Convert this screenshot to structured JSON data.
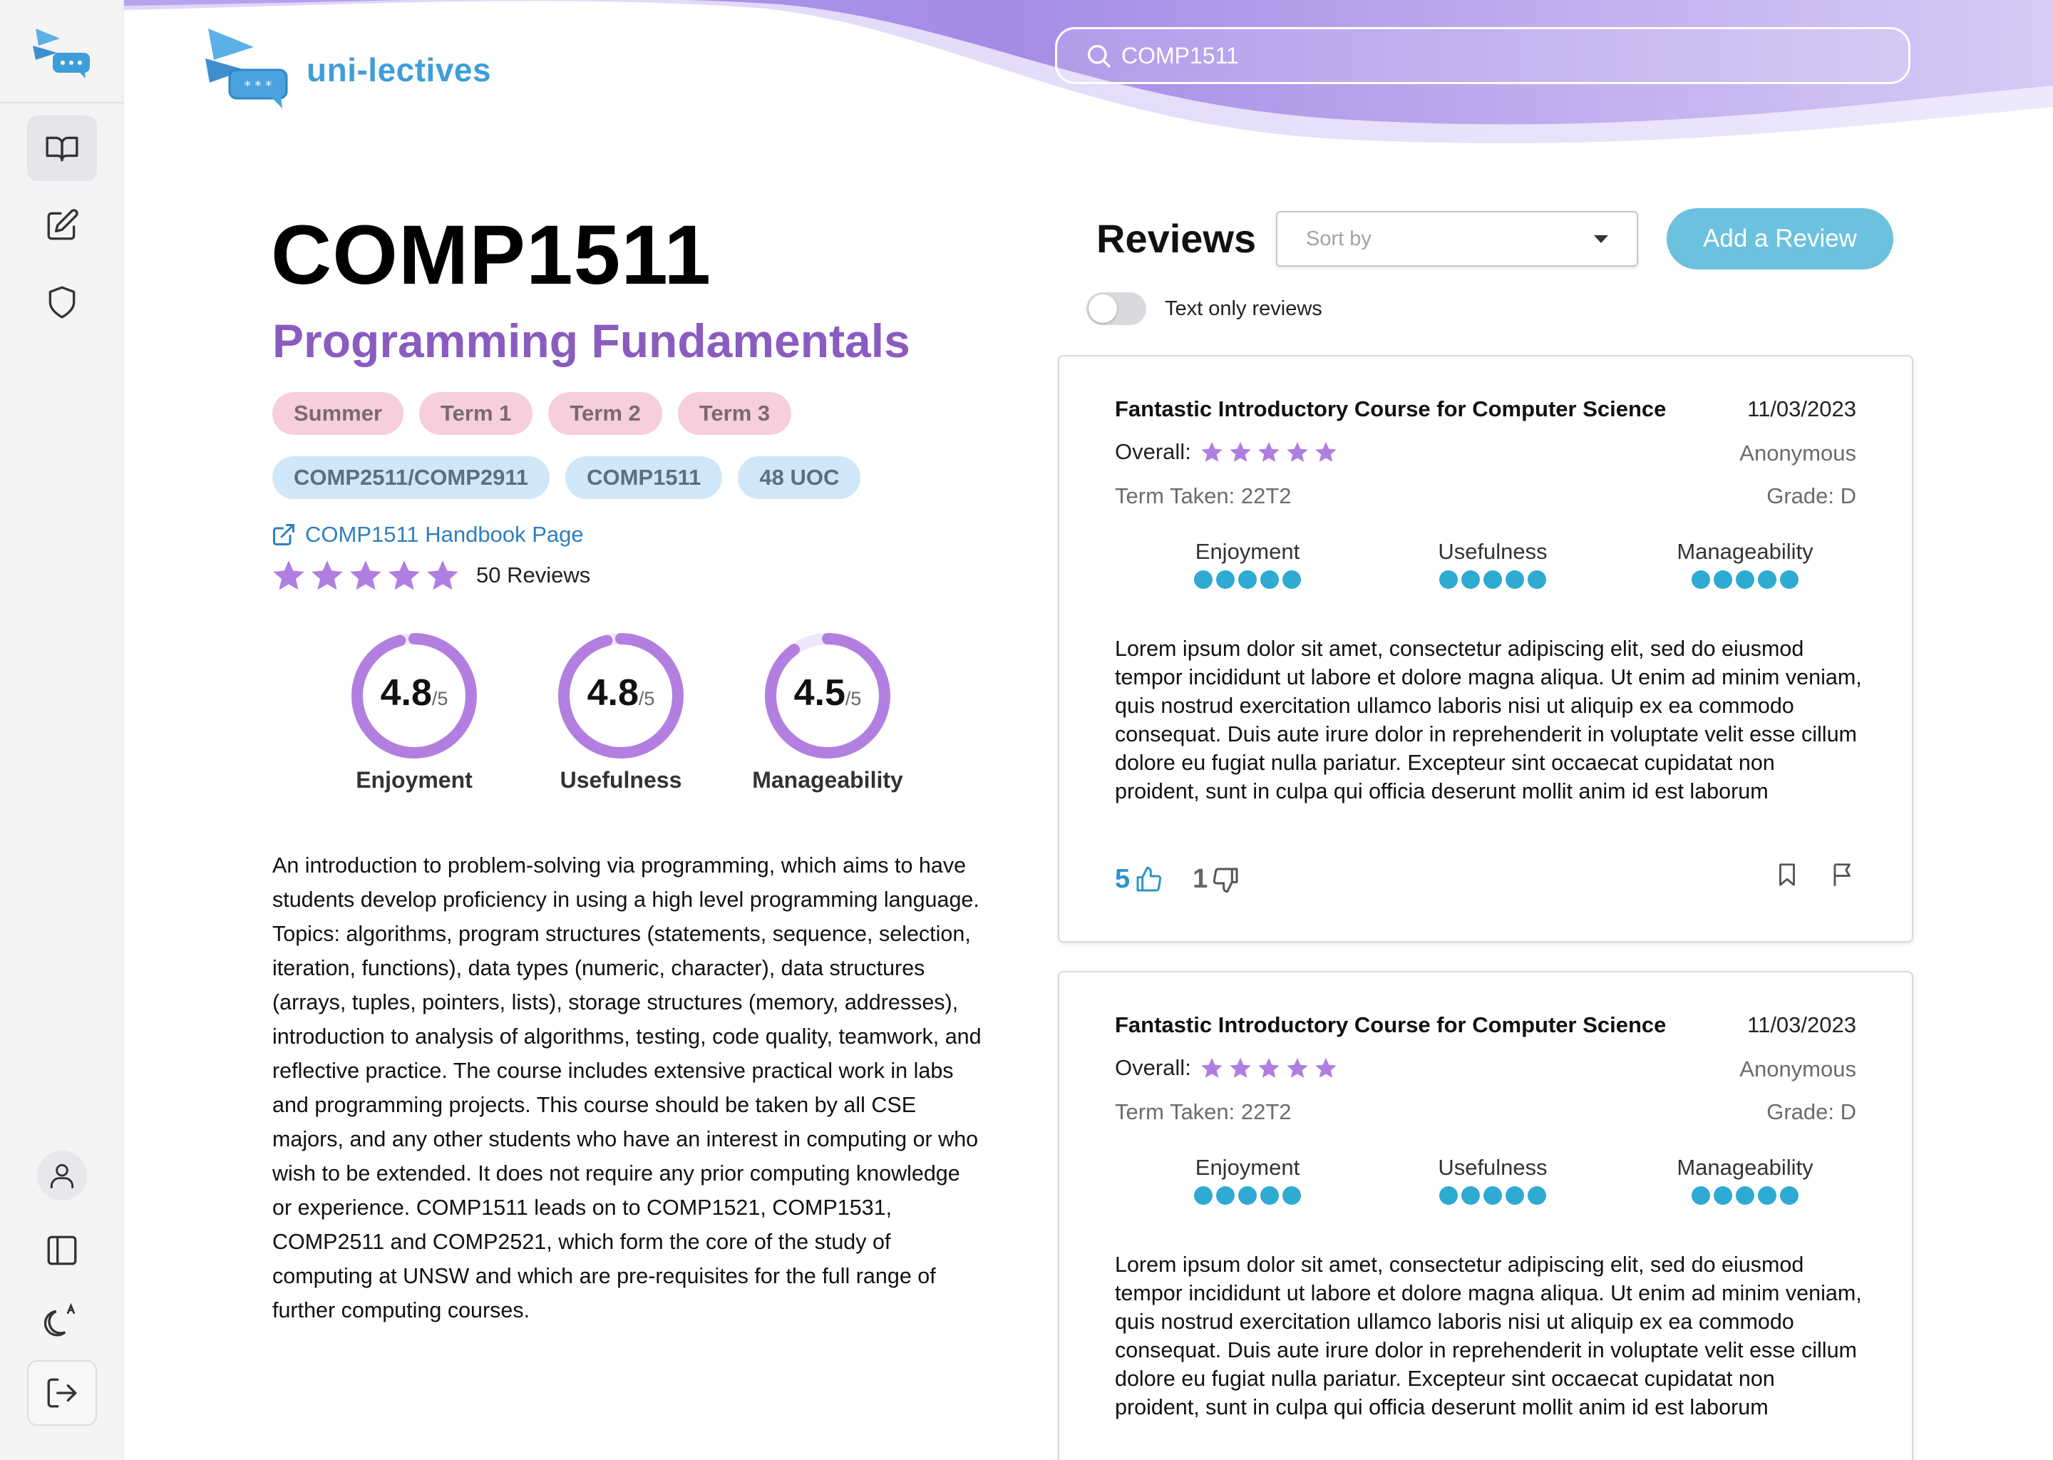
{
  "brand": {
    "name": "uni-lectives"
  },
  "search": {
    "value": "COMP1511",
    "placeholder": "COMP1511"
  },
  "sidebar": {
    "top_items": [
      {
        "name": "browse-courses",
        "icon": "book-open-icon",
        "active": true
      },
      {
        "name": "write-review",
        "icon": "edit-icon",
        "active": false
      },
      {
        "name": "admin",
        "icon": "shield-icon",
        "active": false
      }
    ],
    "bottom_items": [
      {
        "name": "profile",
        "icon": "user-icon"
      },
      {
        "name": "toggle-sidebar",
        "icon": "sidebar-panel-icon"
      },
      {
        "name": "theme",
        "icon": "dark-mode-icon"
      },
      {
        "name": "logout",
        "icon": "logout-icon"
      }
    ]
  },
  "course": {
    "code": "COMP1511",
    "name": "Programming Fundamentals",
    "terms": [
      "Summer",
      "Term 1",
      "Term 2",
      "Term 3"
    ],
    "tags": [
      "COMP2511/COMP2911",
      "COMP1511",
      "48 UOC"
    ],
    "handbook_label": "COMP1511 Handbook Page",
    "overall_stars": 5,
    "reviews_count_label": "50 Reviews",
    "metrics": [
      {
        "label": "Enjoyment",
        "value": "4.8",
        "out_of": "/5",
        "fraction": 0.96
      },
      {
        "label": "Usefulness",
        "value": "4.8",
        "out_of": "/5",
        "fraction": 0.96
      },
      {
        "label": "Manageability",
        "value": "4.5",
        "out_of": "/5",
        "fraction": 0.9
      }
    ],
    "description": "An introduction to problem-solving via programming, which aims to have students develop proficiency in using a high level programming language. Topics: algorithms, program structures (statements, sequence, selection, iteration, functions), data types (numeric, character), data structures (arrays, tuples, pointers, lists), storage structures (memory, addresses), introduction to analysis of algorithms, testing, code quality, teamwork, and reflective practice. The course includes extensive practical work in labs and programming projects. This course should be taken by all CSE majors, and any other students who have an interest in computing or who wish to be extended. It does not require any prior computing knowledge or experience. COMP1511 leads on to COMP1521, COMP1531, COMP2511 and COMP2521, which form the core of the study of computing at UNSW and which are pre-requisites for the full range of further computing courses."
  },
  "reviews_panel": {
    "title": "Reviews",
    "sort_placeholder": "Sort by",
    "add_review_label": "Add a Review",
    "text_only_label": "Text only reviews",
    "text_only_enabled": false
  },
  "reviews": [
    {
      "title": "Fantastic Introductory Course for Computer Science",
      "date": "11/03/2023",
      "overall_label": "Overall:",
      "stars": 5,
      "author": "Anonymous",
      "term_taken": "Term Taken: 22T2",
      "grade": "Grade: D",
      "metrics": [
        {
          "label": "Enjoyment",
          "dots": 5
        },
        {
          "label": "Usefulness",
          "dots": 5
        },
        {
          "label": "Manageability",
          "dots": 5
        }
      ],
      "body": "Lorem ipsum dolor sit amet, consectetur adipiscing elit, sed do eiusmod tempor incididunt ut labore et dolore magna aliqua. Ut enim ad minim veniam, quis nostrud exercitation ullamco laboris nisi ut aliquip ex ea commodo consequat. Duis aute irure dolor in reprehenderit in voluptate velit esse cillum dolore eu fugiat nulla pariatur. Excepteur sint occaecat cupidatat non proident, sunt in culpa qui officia deserunt mollit anim id est laborum",
      "upvotes": "5",
      "downvotes": "1"
    },
    {
      "title": "Fantastic Introductory Course for Computer Science",
      "date": "11/03/2023",
      "overall_label": "Overall:",
      "stars": 5,
      "author": "Anonymous",
      "term_taken": "Term Taken: 22T2",
      "grade": "Grade: D",
      "metrics": [
        {
          "label": "Enjoyment",
          "dots": 5
        },
        {
          "label": "Usefulness",
          "dots": 5
        },
        {
          "label": "Manageability",
          "dots": 5
        }
      ],
      "body": "Lorem ipsum dolor sit amet, consectetur adipiscing elit, sed do eiusmod tempor incididunt ut labore et dolore magna aliqua. Ut enim ad minim veniam, quis nostrud exercitation ullamco laboris nisi ut aliquip ex ea commodo consequat. Duis aute irure dolor in reprehenderit in voluptate velit esse cillum dolore eu fugiat nulla pariatur. Excepteur sint occaecat cupidatat non proident, sunt in culpa qui officia deserunt mollit anim id est laborum",
      "upvotes": "",
      "downvotes": ""
    }
  ],
  "colors": {
    "brand_blue": "#3f9ed8",
    "accent_purple": "#8a5cc0",
    "star_purple": "#b07ee0",
    "gauge_purple": "#b27fe0",
    "dot_blue": "#2eaad3",
    "button_blue": "#6cc2de"
  }
}
